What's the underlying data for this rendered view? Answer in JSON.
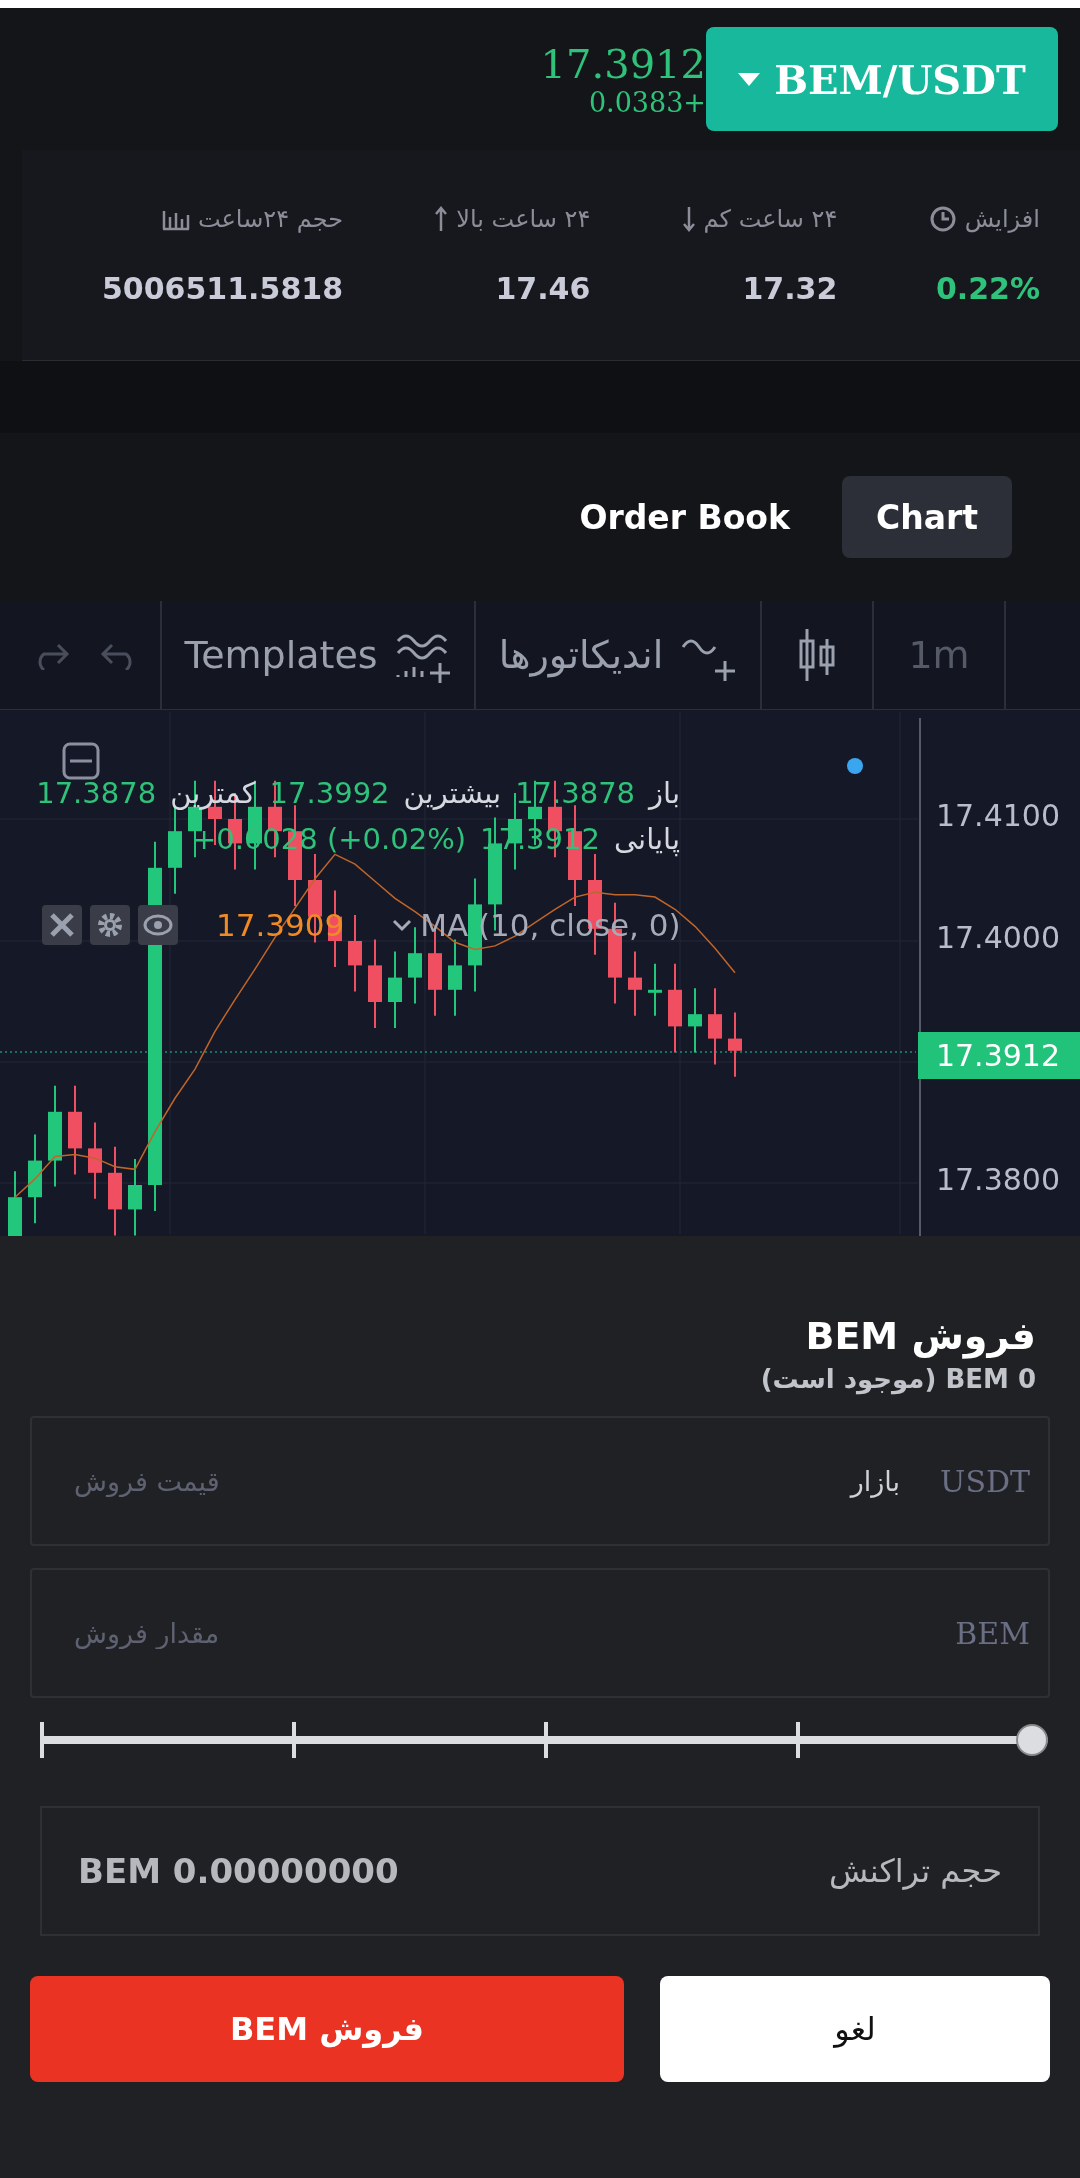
{
  "header": {
    "pair": "BEM/USDT",
    "price": "17.3912",
    "change": "0.0383+"
  },
  "stats": [
    {
      "kind": "change",
      "label": "افزایش",
      "value": "0.22%"
    },
    {
      "kind": "low",
      "label": "۲۴ ساعت کم",
      "value": "17.32"
    },
    {
      "kind": "high",
      "label": "۲۴ ساعت بالا",
      "value": "17.46"
    },
    {
      "kind": "volume",
      "label": "حجم ۲۴ساعت",
      "value": "5006511.5818"
    }
  ],
  "view_tabs": [
    {
      "label": "Chart",
      "selected": true
    },
    {
      "label": "Order Book",
      "selected": false
    }
  ],
  "toolbar": {
    "interval": "1m",
    "indicators": "اندیکاتورها",
    "templates": "Templates"
  },
  "chart": {
    "legend": [
      {
        "label": "باز",
        "value": "17.3878"
      },
      {
        "label": "بیشترین",
        "value": "17.3992"
      },
      {
        "label": "کمترین",
        "value": "17.3878"
      }
    ],
    "close": {
      "label": "پایانی",
      "value": "17.3912"
    },
    "change": "+0.0028 (+0.02%)",
    "indicator": {
      "name": "MA (10, close, 0)",
      "value": "17.3909"
    },
    "price_axis": [
      "17.4100",
      "17.4000",
      "17.3800"
    ],
    "last_price": "17.3912"
  },
  "sell": {
    "title": "فروش BEM",
    "available": "0 BEM (موجود است)",
    "price_field": {
      "placeholder": "قیمت فروش",
      "mode": "بازار",
      "unit": "USDT"
    },
    "amount_field": {
      "placeholder": "مقدار فروش",
      "unit": "BEM"
    },
    "slider": {
      "level": 1
    },
    "total": {
      "label": "حجم تراکنش",
      "value": "BEM 0.00000000"
    },
    "buttons": [
      {
        "kind": "cancel",
        "label": "لغو"
      },
      {
        "kind": "sell",
        "label": "فروش BEM"
      }
    ]
  }
}
